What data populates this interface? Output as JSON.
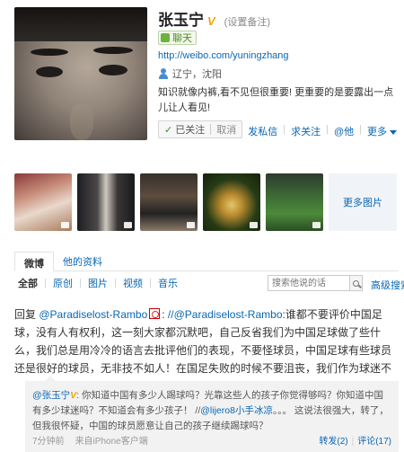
{
  "profile": {
    "name": "张玉宁",
    "verified_badge": "V",
    "remark_link": "(设置备注)",
    "chat_label": "聊天",
    "url": "http://weibo.com/yuningzhang",
    "location": "辽宁，沈阳",
    "bio": "知识就像内裤,看不见但很重要! 更重要的是要露出一点儿让人看见!",
    "follow_status": "已关注",
    "unfollow": "取消",
    "actions": [
      "发私信",
      "求关注",
      "@他",
      "更多"
    ]
  },
  "photos": {
    "more_label": "更多图片"
  },
  "tabs": [
    "微博",
    "他的资料"
  ],
  "filter": {
    "items": [
      "全部",
      "原创",
      "图片",
      "视频",
      "音乐"
    ],
    "search_placeholder": "搜索他说的话",
    "advanced": "高级搜索"
  },
  "post": {
    "prefix": "回复 ",
    "mention1": "@Paradiselost-Rambo",
    "sep": ": ",
    "mention_chain": "//@Paradiselost-Rambo",
    "text": ":谁都不要评价中国足球，没有人有权利，这一刻大家都沉默吧，自己反省我们为中国足球做了些什么，我们总是用冷冷的语言去批评他们的表现，不要怪球员，中国足球有些球员还是很好的球员，无非技不如人！在国足失败的时候不要沮丧，我们作为球迷不",
    "repost": {
      "author": "@张玉宁",
      "badge": "V",
      "text1": ": 你知道中国有多少人踢球吗？光靠这些人的孩子你觉得够吗？你知道中国有多少球迷吗？不知道会有多少孩子！ //",
      "mention": "@lijero8小手冰凉",
      "text2": "。。。 这说法很强大，转了，但我很怀疑，中国的球员愿意让自己的孩子继续踢球吗？",
      "time": "7分钟前",
      "source": "来自iPhone客户端",
      "repost_count": "转发(2)",
      "comment_count": "评论(17)"
    }
  },
  "colors": {
    "link": "#0a67b3",
    "badge": "#f5a300",
    "chat": "#6cb33b"
  }
}
